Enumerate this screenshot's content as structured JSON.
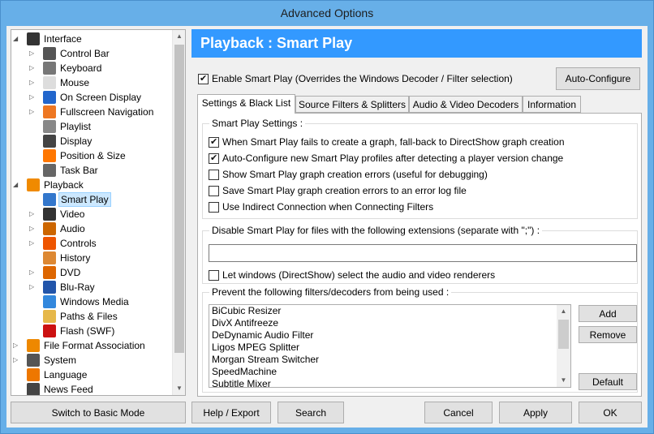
{
  "window": {
    "title": "Advanced Options"
  },
  "tree": {
    "items": [
      {
        "label": "Interface",
        "level": 0,
        "expander": "◢",
        "icon": "interface-icon",
        "color": "#333333"
      },
      {
        "label": "Control Bar",
        "level": 1,
        "expander": "▷",
        "icon": "control-bar-icon",
        "color": "#555555"
      },
      {
        "label": "Keyboard",
        "level": 1,
        "expander": "▷",
        "icon": "keyboard-icon",
        "color": "#777777"
      },
      {
        "label": "Mouse",
        "level": 1,
        "expander": "▷",
        "icon": "mouse-icon",
        "color": "#dddddd"
      },
      {
        "label": "On Screen Display",
        "level": 1,
        "expander": "▷",
        "icon": "osd-icon",
        "color": "#2266cc"
      },
      {
        "label": "Fullscreen Navigation",
        "level": 1,
        "expander": "▷",
        "icon": "fullscreen-icon",
        "color": "#ee7722"
      },
      {
        "label": "Playlist",
        "level": 1,
        "expander": "",
        "icon": "playlist-icon",
        "color": "#888888"
      },
      {
        "label": "Display",
        "level": 1,
        "expander": "",
        "icon": "display-icon",
        "color": "#444444"
      },
      {
        "label": "Position & Size",
        "level": 1,
        "expander": "",
        "icon": "position-icon",
        "color": "#ff7700"
      },
      {
        "label": "Task Bar",
        "level": 1,
        "expander": "",
        "icon": "taskbar-icon",
        "color": "#666666"
      },
      {
        "label": "Playback",
        "level": 0,
        "expander": "◢",
        "icon": "playback-icon",
        "color": "#f08a00"
      },
      {
        "label": "Smart Play",
        "level": 1,
        "expander": "",
        "icon": "smart-play-icon",
        "color": "#3377cc",
        "selected": true
      },
      {
        "label": "Video",
        "level": 1,
        "expander": "▷",
        "icon": "video-icon",
        "color": "#333333"
      },
      {
        "label": "Audio",
        "level": 1,
        "expander": "▷",
        "icon": "audio-icon",
        "color": "#cc6600"
      },
      {
        "label": "Controls",
        "level": 1,
        "expander": "▷",
        "icon": "controls-icon",
        "color": "#ee5500"
      },
      {
        "label": "History",
        "level": 1,
        "expander": "",
        "icon": "history-icon",
        "color": "#dd8833"
      },
      {
        "label": "DVD",
        "level": 1,
        "expander": "▷",
        "icon": "dvd-icon",
        "color": "#dd6600"
      },
      {
        "label": "Blu-Ray",
        "level": 1,
        "expander": "▷",
        "icon": "bluray-icon",
        "color": "#2255aa"
      },
      {
        "label": "Windows Media",
        "level": 1,
        "expander": "",
        "icon": "windows-media-icon",
        "color": "#3388dd"
      },
      {
        "label": "Paths & Files",
        "level": 1,
        "expander": "",
        "icon": "folder-icon",
        "color": "#e6b84a"
      },
      {
        "label": "Flash (SWF)",
        "level": 1,
        "expander": "",
        "icon": "flash-icon",
        "color": "#cc1111"
      },
      {
        "label": "File Format Association",
        "level": 0,
        "expander": "▷",
        "icon": "file-format-icon",
        "color": "#ee8800"
      },
      {
        "label": "System",
        "level": 0,
        "expander": "▷",
        "icon": "system-icon",
        "color": "#555555"
      },
      {
        "label": "Language",
        "level": 0,
        "expander": "",
        "icon": "language-icon",
        "color": "#ee7700"
      },
      {
        "label": "News Feed",
        "level": 0,
        "expander": "",
        "icon": "news-icon",
        "color": "#444444"
      }
    ]
  },
  "panel": {
    "title": "Playback : Smart Play",
    "enable_label": "Enable Smart Play (Overrides the Windows Decoder / Filter selection)",
    "enable_checked": true,
    "auto_configure": "Auto-Configure"
  },
  "tabs": [
    {
      "label": "Settings & Black List",
      "active": true
    },
    {
      "label": "Source Filters & Splitters",
      "active": false
    },
    {
      "label": "Audio & Video Decoders",
      "active": false
    },
    {
      "label": "Information",
      "active": false
    }
  ],
  "settings_group": {
    "title": "Smart Play Settings :",
    "options": [
      {
        "label": "When Smart Play fails to create a graph, fall-back to DirectShow graph creation",
        "checked": true
      },
      {
        "label": "Auto-Configure new Smart Play profiles after detecting a player version change",
        "checked": true
      },
      {
        "label": "Show Smart Play graph creation errors (useful for debugging)",
        "checked": false
      },
      {
        "label": "Save Smart Play graph creation errors to an error log file",
        "checked": false
      },
      {
        "label": "Use Indirect Connection when Connecting Filters",
        "checked": false
      }
    ]
  },
  "extensions_group": {
    "title": "Disable Smart Play for files with the following extensions (separate with \";\") :",
    "value": "",
    "windows_label": "Let windows (DirectShow) select the audio and video renderers",
    "windows_checked": false
  },
  "filters_group": {
    "title": "Prevent the following filters/decoders from being used :",
    "items": [
      "BiCubic Resizer",
      "DivX Antifreeze",
      "DeDynamic Audio Filter",
      "Ligos MPEG Splitter",
      "Morgan Stream Switcher",
      "SpeedMachine",
      "Subtitle Mixer"
    ],
    "add": "Add",
    "remove": "Remove",
    "default": "Default"
  },
  "footer": {
    "basic_mode": "Switch to Basic Mode",
    "help_export": "Help / Export",
    "search": "Search",
    "cancel": "Cancel",
    "apply": "Apply",
    "ok": "OK"
  }
}
